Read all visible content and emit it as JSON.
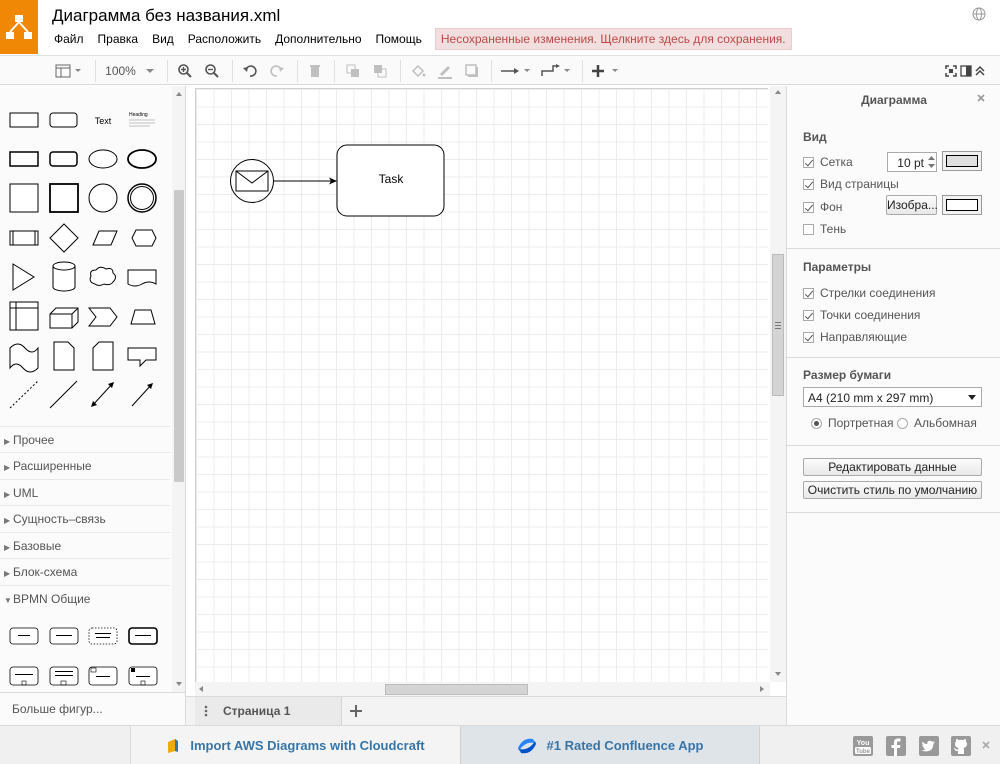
{
  "app": {
    "title": "Диаграмма без названия.xml"
  },
  "menu": {
    "items": [
      "Файл",
      "Правка",
      "Вид",
      "Расположить",
      "Дополнительно",
      "Помощь"
    ],
    "unsaved_notice": "Несохраненные изменения. Щелкните здесь для сохранения."
  },
  "toolbar": {
    "zoom": "100%"
  },
  "shapes": {
    "text_label": "Text",
    "heading_label": "Heading"
  },
  "sidebar": {
    "sections": [
      {
        "label": "Прочее",
        "expanded": false
      },
      {
        "label": "Расширенные",
        "expanded": false
      },
      {
        "label": "UML",
        "expanded": false
      },
      {
        "label": "Сущность–связь",
        "expanded": false
      },
      {
        "label": "Базовые",
        "expanded": false
      },
      {
        "label": "Блок-схема",
        "expanded": false
      },
      {
        "label": "BPMN Общие",
        "expanded": true
      }
    ],
    "more_shapes": "Больше фигур..."
  },
  "canvas": {
    "task_label": "Task"
  },
  "pages": {
    "current": "Страница 1"
  },
  "format": {
    "title": "Диаграмма",
    "view": {
      "heading": "Вид",
      "grid_label": "Сетка",
      "grid_checked": true,
      "grid_size": "10 pt",
      "page_view_label": "Вид страницы",
      "page_view_checked": true,
      "background_label": "Фон",
      "background_checked": true,
      "image_button": "Изобра...",
      "shadow_label": "Тень",
      "shadow_checked": false
    },
    "options": {
      "heading": "Параметры",
      "connection_arrows": "Стрелки соединения",
      "connection_points": "Точки соединения",
      "guides": "Направляющие"
    },
    "paper": {
      "heading": "Размер бумаги",
      "size": "A4 (210 mm x 297 mm)",
      "portrait": "Портретная",
      "landscape": "Альбомная",
      "orientation": "portrait"
    },
    "buttons": {
      "edit_data": "Редактировать данные",
      "clear_style": "Очистить стиль по умолчанию"
    }
  },
  "footer": {
    "ad1": "Import AWS Diagrams with Cloudcraft",
    "ad2": "#1 Rated Confluence App",
    "social": [
      "youtube-icon",
      "facebook-icon",
      "twitter-icon",
      "github-icon"
    ]
  },
  "colors": {
    "logo": "#f08705",
    "unsaved_bg": "#f2dede",
    "unsaved_text": "#b94a48",
    "ad_link": "#3875a7"
  }
}
